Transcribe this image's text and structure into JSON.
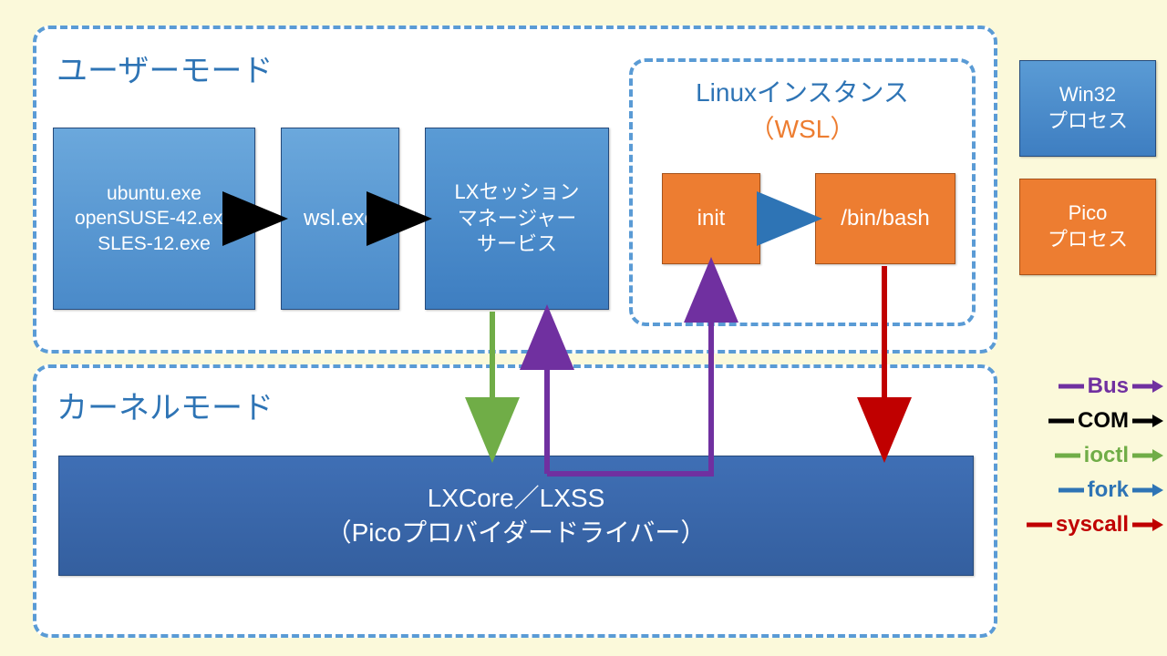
{
  "sections": {
    "user_mode": "ユーザーモード",
    "kernel_mode": "カーネルモード",
    "linux_instance_l1": "Linuxインスタンス",
    "linux_instance_l2": "（WSL）"
  },
  "boxes": {
    "launchers": "ubuntu.exe\nopenSUSE-42.exe\nSLES-12.exe",
    "wsl": "wsl.exe",
    "lxsession": "LXセッション\nマネージャー\nサービス",
    "init": "init",
    "binbash": "/bin/bash",
    "win32": "Win32\nプロセス",
    "pico": "Pico\nプロセス",
    "lxcore_l1": "LXCore／LXSS",
    "lxcore_l2": "（Picoプロバイダードライバー）"
  },
  "legend": {
    "bus": "Bus",
    "com": "COM",
    "ioctl": "ioctl",
    "fork": "fork",
    "syscall": "syscall"
  },
  "colors": {
    "bus": "#7030a0",
    "com": "#000000",
    "ioctl": "#70ad47",
    "fork": "#2e74b5",
    "syscall": "#c00000"
  }
}
